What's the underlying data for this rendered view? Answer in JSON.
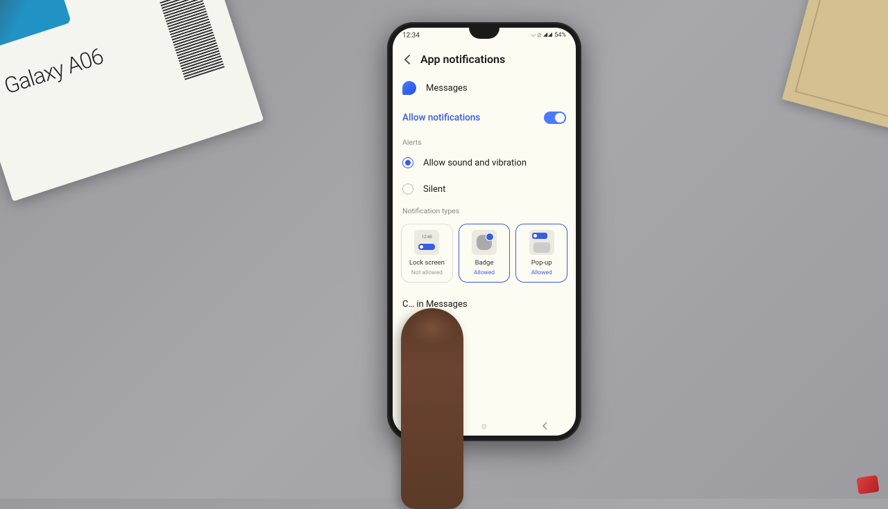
{
  "box_product": "Galaxy A06",
  "status": {
    "time": "12:34",
    "battery": "54%",
    "icons": "⌵ ⊘ ◢◢"
  },
  "header": {
    "title": "App notifications"
  },
  "app": {
    "name": "Messages"
  },
  "allow": {
    "label": "Allow notifications",
    "enabled": true
  },
  "sections": {
    "alerts": "Alerts",
    "types": "Notification types"
  },
  "radios": [
    {
      "label": "Allow sound and vibration",
      "checked": true
    },
    {
      "label": "Silent",
      "checked": false
    }
  ],
  "type_cards": {
    "lock": {
      "title": "Lock screen",
      "status": "Not allowed",
      "preview_time": "12:45",
      "selected": false
    },
    "badge": {
      "title": "Badge",
      "status": "Allowed",
      "selected": true
    },
    "popup": {
      "title": "Pop-up",
      "status": "Allowed",
      "selected": true
    }
  },
  "bottom_link_partial": "C… in Messages"
}
